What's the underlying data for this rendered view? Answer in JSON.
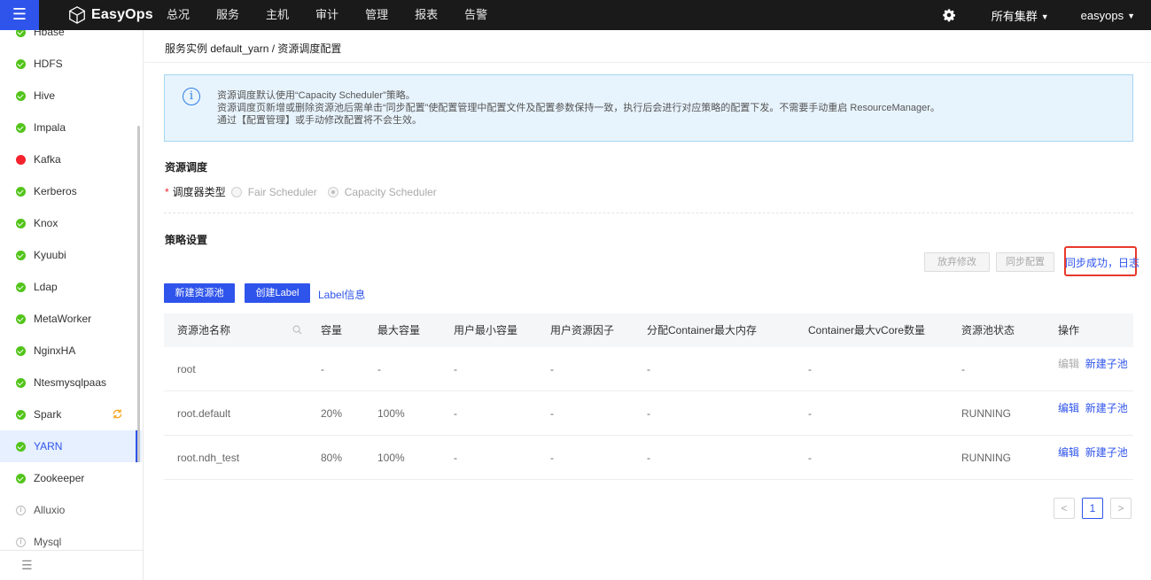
{
  "topbar": {
    "brand": "EasyOps",
    "nav": [
      "总况",
      "服务",
      "主机",
      "审计",
      "管理",
      "报表",
      "告警"
    ],
    "cluster": "所有集群",
    "user": "easyops"
  },
  "sidebar": {
    "items": [
      {
        "label": "Hbase",
        "status": "ok"
      },
      {
        "label": "HDFS",
        "status": "ok"
      },
      {
        "label": "Hive",
        "status": "ok"
      },
      {
        "label": "Impala",
        "status": "ok"
      },
      {
        "label": "Kafka",
        "status": "error"
      },
      {
        "label": "Kerberos",
        "status": "ok"
      },
      {
        "label": "Knox",
        "status": "ok"
      },
      {
        "label": "Kyuubi",
        "status": "ok"
      },
      {
        "label": "Ldap",
        "status": "ok"
      },
      {
        "label": "MetaWorker",
        "status": "ok"
      },
      {
        "label": "NginxHA",
        "status": "ok"
      },
      {
        "label": "Ntesmysqlpaas",
        "status": "ok"
      },
      {
        "label": "Spark",
        "status": "ok"
      },
      {
        "label": "YARN",
        "status": "ok",
        "active": true
      },
      {
        "label": "Zookeeper",
        "status": "ok"
      },
      {
        "label": "Alluxio",
        "status": "info"
      },
      {
        "label": "Mysql",
        "status": "info"
      }
    ]
  },
  "breadcrumb": "服务实例 default_yarn / 资源调度配置",
  "alert": {
    "lines": [
      "资源调度默认使用“Capacity Scheduler”策略。",
      "资源调度页新增或删除资源池后需单击“同步配置”使配置管理中配置文件及配置参数保持一致，执行后会进行对应策略的配置下发。不需要手动重启 ResourceManager。",
      "通过【配置管理】或手动修改配置将不会生效。"
    ]
  },
  "scheduling": {
    "title": "资源调度",
    "field_label": "调度器类型",
    "options": [
      "Fair Scheduler",
      "Capacity Scheduler"
    ],
    "selected": "Capacity Scheduler"
  },
  "policy": {
    "title": "策略设置",
    "discard": "放弃修改",
    "sync": "同步配置",
    "sync_status": "同步成功，日志",
    "new_pool": "新建资源池",
    "create_label": "创建Label",
    "label_info": "Label信息"
  },
  "table": {
    "headers": [
      "资源池名称",
      "容量",
      "最大容量",
      "用户最小容量",
      "用户资源因子",
      "分配Container最大内存",
      "Container最大vCore数量",
      "资源池状态",
      "操作"
    ],
    "rows": [
      {
        "name": "root",
        "capacity": "-",
        "max_capacity": "-",
        "user_min": "-",
        "user_factor": "-",
        "max_mem": "-",
        "max_vcore": "-",
        "state": "-",
        "edit": "编辑",
        "new_child": "新建子池",
        "edit_disabled": true
      },
      {
        "name": "root.default",
        "capacity": "20%",
        "max_capacity": "100%",
        "user_min": "-",
        "user_factor": "-",
        "max_mem": "-",
        "max_vcore": "-",
        "state": "RUNNING",
        "edit": "编辑",
        "new_child": "新建子池",
        "edit_disabled": false
      },
      {
        "name": "root.ndh_test",
        "capacity": "80%",
        "max_capacity": "100%",
        "user_min": "-",
        "user_factor": "-",
        "max_mem": "-",
        "max_vcore": "-",
        "state": "RUNNING",
        "edit": "编辑",
        "new_child": "新建子池",
        "edit_disabled": false
      }
    ]
  },
  "pagination": {
    "prev": "<",
    "current": "1",
    "next": ">"
  },
  "colors": {
    "brand": "#2f54eb",
    "ok": "#52c41a",
    "error": "#f5222d",
    "highlight": "#e8392b"
  }
}
